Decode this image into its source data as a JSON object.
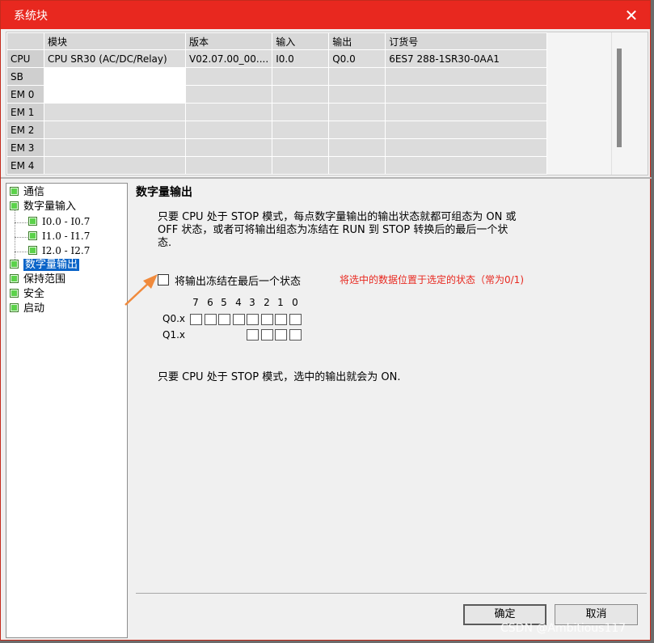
{
  "window": {
    "title": "系统块",
    "close_glyph": "✕"
  },
  "grid": {
    "headers": [
      "模块",
      "版本",
      "输入",
      "输出",
      "订货号"
    ],
    "rows": [
      {
        "slot": "CPU",
        "module": "CPU SR30 (AC/DC/Relay)",
        "version": "V02.07.00_00....",
        "input": "I0.0",
        "output": "Q0.0",
        "order": "6ES7 288-1SR30-0AA1"
      },
      {
        "slot": "SB",
        "module": "",
        "version": "",
        "input": "",
        "output": "",
        "order": ""
      },
      {
        "slot": "EM 0",
        "module": "",
        "version": "",
        "input": "",
        "output": "",
        "order": ""
      },
      {
        "slot": "EM 1",
        "module": "",
        "version": "",
        "input": "",
        "output": "",
        "order": ""
      },
      {
        "slot": "EM 2",
        "module": "",
        "version": "",
        "input": "",
        "output": "",
        "order": ""
      },
      {
        "slot": "EM 3",
        "module": "",
        "version": "",
        "input": "",
        "output": "",
        "order": ""
      },
      {
        "slot": "EM 4",
        "module": "",
        "version": "",
        "input": "",
        "output": "",
        "order": ""
      }
    ]
  },
  "tree": {
    "items": [
      {
        "label": "通信"
      },
      {
        "label": "数字量输入"
      },
      {
        "label": "I0.0 - I0.7"
      },
      {
        "label": "I1.0 - I1.7"
      },
      {
        "label": "I2.0 - I2.7"
      },
      {
        "label": "数字量输出",
        "selected": true
      },
      {
        "label": "保持范围"
      },
      {
        "label": "安全"
      },
      {
        "label": "启动"
      }
    ]
  },
  "panel": {
    "heading": "数字量输出",
    "description_line1": "只要 CPU 处于 STOP 模式，每点数字量输出的输出状态就都可组态为 ON 或",
    "description_line2": "OFF 状态，或者可将输出组态为冻结在 RUN 到 STOP 转换后的最后一个状",
    "description_line3": "态.",
    "freeze_label": "将输出冻结在最后一个状态",
    "freeze_checked": false,
    "annotation": "将选中的数据位置于选定的状态（常为0/1)",
    "bit_numbers": [
      "7",
      "6",
      "5",
      "4",
      "3",
      "2",
      "1",
      "0"
    ],
    "row_q0": "Q0.x",
    "row_q1": "Q1.x",
    "q0_bit_count": 8,
    "q1_bit_count": 4,
    "description2": "只要 CPU 处于 STOP 模式，选中的输出就会为 ON."
  },
  "buttons": {
    "ok": "确定",
    "cancel": "取消"
  },
  "watermark": "CSDN @Ambitious117",
  "colors": {
    "titlebar": "#e8281f",
    "annotation": "#e8281f",
    "arrow": "#f08a3c",
    "selection": "#0a64c8"
  }
}
